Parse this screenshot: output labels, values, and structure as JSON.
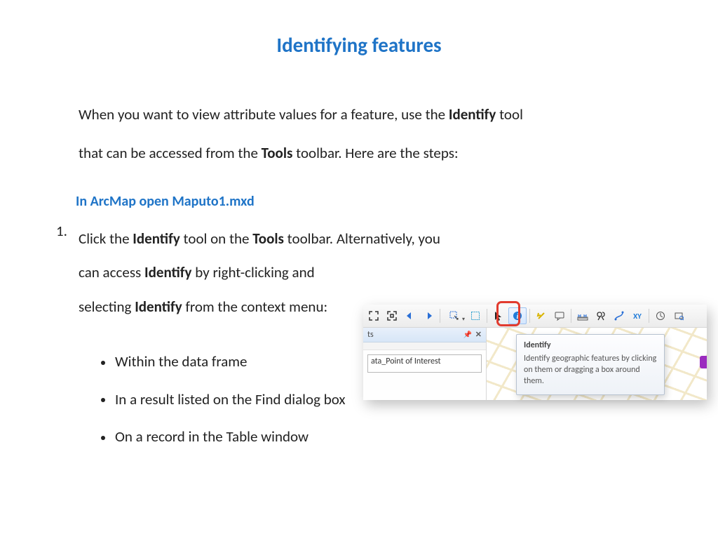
{
  "title": "Identifying features",
  "intro": {
    "pre1": "When you want to view attribute values for a feature, use the ",
    "bold1": "Identify",
    "post1": " tool",
    "pre2": "that can be accessed from the ",
    "bold2": "Tools",
    "post2": " toolbar. Here are the steps:"
  },
  "sub_heading": "In ArcMap open Maputo1.mxd",
  "step": {
    "number": "1.",
    "seg1a": "Click the ",
    "seg1b": "Identify",
    "seg1c": " tool on the ",
    "seg1d": "Tools",
    "seg1e": " toolbar. Alternatively, you",
    "seg2a": "can access ",
    "seg2b": "Identify",
    "seg2c": " by right-clicking and",
    "seg3a": "selecting ",
    "seg3b": "Identify ",
    "seg3c": "from the context menu:"
  },
  "bullets": [
    "Within the data frame",
    "In a result listed on the Find dialog box",
    "On a record in the Table window"
  ],
  "shot": {
    "panel_title": "ts",
    "pin_symbol": "📌",
    "close_symbol": "✕",
    "field_value": "ata_Point of Interest",
    "tooltip_title": "Identify",
    "tooltip_body": "Identify geographic features by clicking on them or dragging a box around them."
  }
}
